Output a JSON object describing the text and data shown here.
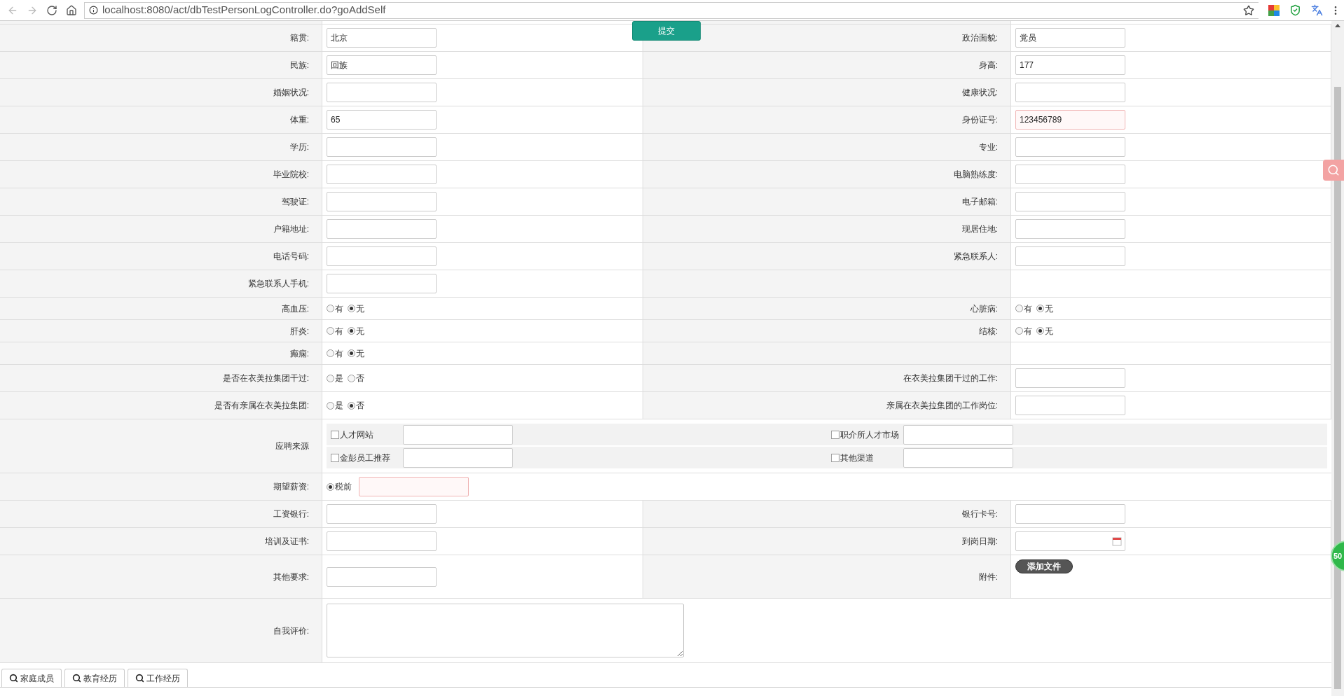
{
  "browser": {
    "url": "localhost:8080/act/dbTestPersonLogController.do?goAddSelf"
  },
  "submit_button": "提交",
  "rows": [
    {
      "kind": "pair",
      "left": {
        "kind": "field",
        "label": "籍贯:",
        "value": "北京",
        "invalid": false
      },
      "right": {
        "kind": "field",
        "label": "政治面貌:",
        "value": "党员",
        "invalid": false
      }
    },
    {
      "kind": "pair",
      "left": {
        "kind": "field",
        "label": "民族:",
        "value": "回族",
        "invalid": false
      },
      "right": {
        "kind": "field",
        "label": "身高:",
        "value": "177",
        "invalid": false
      }
    },
    {
      "kind": "pair",
      "left": {
        "kind": "field",
        "label": "婚姻状况:",
        "invalid": false
      },
      "right": {
        "kind": "field",
        "label": "健康状况:",
        "invalid": false
      }
    },
    {
      "kind": "pair",
      "left": {
        "kind": "field",
        "label": "体重:",
        "value": "65",
        "invalid": false
      },
      "right": {
        "kind": "field",
        "label": "身份证号:",
        "value": "123456789",
        "invalid": true
      }
    },
    {
      "kind": "pair",
      "left": {
        "kind": "field",
        "label": "学历:",
        "invalid": false
      },
      "right": {
        "kind": "field",
        "label": "专业:",
        "invalid": false
      }
    },
    {
      "kind": "pair",
      "left": {
        "kind": "field",
        "label": "毕业院校:",
        "invalid": false
      },
      "right": {
        "kind": "field",
        "label": "电脑熟练度:",
        "invalid": false
      }
    },
    {
      "kind": "pair",
      "left": {
        "kind": "field",
        "label": "驾驶证:",
        "invalid": false
      },
      "right": {
        "kind": "field",
        "label": "电子邮箱:",
        "invalid": false
      }
    },
    {
      "kind": "pair",
      "left": {
        "kind": "field",
        "label": "户籍地址:",
        "invalid": false
      },
      "right": {
        "kind": "field",
        "label": "现居住地:",
        "invalid": false
      }
    },
    {
      "kind": "pair",
      "left": {
        "kind": "field",
        "label": "电话号码:",
        "invalid": false
      },
      "right": {
        "kind": "field",
        "label": "紧急联系人:",
        "invalid": false
      }
    },
    {
      "kind": "pair",
      "left": {
        "kind": "field",
        "label": "紧急联系人手机:",
        "invalid": false
      }
    },
    {
      "kind": "pair",
      "left": {
        "kind": "radio",
        "label": "高血压:",
        "options": [
          {
            "text": "有",
            "selected": false
          },
          {
            "text": "无",
            "selected": true
          }
        ]
      },
      "right": {
        "kind": "radio",
        "label": "心脏病:",
        "options": [
          {
            "text": "有",
            "selected": false
          },
          {
            "text": "无",
            "selected": true
          }
        ]
      }
    },
    {
      "kind": "pair",
      "left": {
        "kind": "radio",
        "label": "肝炎:",
        "options": [
          {
            "text": "有",
            "selected": false
          },
          {
            "text": "无",
            "selected": true
          }
        ]
      },
      "right": {
        "kind": "radio",
        "label": "结核:",
        "options": [
          {
            "text": "有",
            "selected": false
          },
          {
            "text": "无",
            "selected": true
          }
        ]
      }
    },
    {
      "kind": "pair",
      "left": {
        "kind": "radio",
        "label": "癫痫:",
        "options": [
          {
            "text": "有",
            "selected": false
          },
          {
            "text": "无",
            "selected": true
          }
        ]
      }
    },
    {
      "kind": "pair",
      "left": {
        "kind": "radio",
        "label": "是否在衣美拉集团干过:",
        "options": [
          {
            "text": "是",
            "selected": false
          },
          {
            "text": "否",
            "selected": false
          }
        ]
      },
      "right": {
        "kind": "field",
        "label": "在衣美拉集团干过的工作:",
        "invalid": false
      }
    },
    {
      "kind": "pair",
      "left": {
        "kind": "radio",
        "label": "是否有亲属在衣美拉集团:",
        "options": [
          {
            "text": "是",
            "selected": false
          },
          {
            "text": "否",
            "selected": true
          }
        ]
      },
      "right": {
        "kind": "field",
        "label": "亲属在衣美拉集团的工作岗位:",
        "invalid": false
      }
    },
    {
      "kind": "sources",
      "label": "应聘来源",
      "items": [
        {
          "text": "人才网站",
          "checked": false
        },
        {
          "text": "职介所人才市场",
          "checked": false
        },
        {
          "text": "金彭员工推荐",
          "checked": false
        },
        {
          "text": "其他渠道",
          "checked": false
        }
      ]
    },
    {
      "kind": "salary",
      "label": "期望薪资:",
      "option": {
        "text": "税前",
        "selected": true
      },
      "invalid": true
    },
    {
      "kind": "pair",
      "left": {
        "kind": "field",
        "label": "工资银行:",
        "invalid": false
      },
      "right": {
        "kind": "field",
        "label": "银行卡号:",
        "invalid": false
      }
    },
    {
      "kind": "pair",
      "left": {
        "kind": "field",
        "label": "培训及证书:",
        "invalid": false
      },
      "right": {
        "kind": "date",
        "label": "到岗日期:"
      }
    },
    {
      "kind": "pair",
      "left": {
        "kind": "field",
        "label": "其他要求:",
        "invalid": false
      },
      "right": {
        "kind": "upload",
        "label": "附件:",
        "button": "添加文件"
      }
    },
    {
      "kind": "textarea",
      "label": "自我评价:"
    }
  ],
  "tabs": [
    {
      "label": "家庭成员"
    },
    {
      "label": "教育经历"
    },
    {
      "label": "工作经历"
    }
  ],
  "side_badge": "50"
}
